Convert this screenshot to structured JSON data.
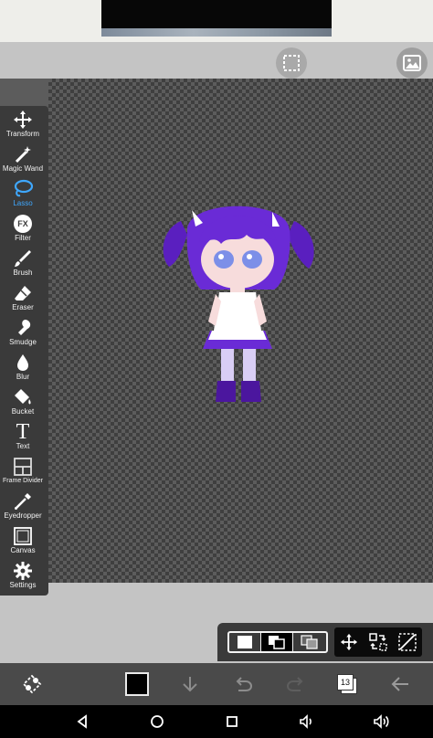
{
  "ad": {
    "banner": "ad-banner"
  },
  "tools": [
    {
      "label": "Transform",
      "icon": "move-arrows-icon"
    },
    {
      "label": "Magic Wand",
      "icon": "magic-wand-icon"
    },
    {
      "label": "Lasso",
      "icon": "lasso-icon",
      "active": true
    },
    {
      "label": "Filter",
      "icon": "fx-icon"
    },
    {
      "label": "Brush",
      "icon": "brush-icon"
    },
    {
      "label": "Eraser",
      "icon": "eraser-icon"
    },
    {
      "label": "Smudge",
      "icon": "smudge-icon"
    },
    {
      "label": "Blur",
      "icon": "drop-icon"
    },
    {
      "label": "Bucket",
      "icon": "bucket-icon"
    },
    {
      "label": "Text",
      "icon": "text-icon"
    },
    {
      "label": "Frame Divider",
      "icon": "frame-divider-icon"
    },
    {
      "label": "Eyedropper",
      "icon": "eyedropper-icon"
    },
    {
      "label": "Canvas",
      "icon": "canvas-icon"
    },
    {
      "label": "Settings",
      "icon": "gear-icon"
    }
  ],
  "fx_text": "FX",
  "text_tool_glyph": "T",
  "bottom": {
    "color": "#000000",
    "layer_count": "13"
  },
  "colors": {
    "accent": "#3fa8ff",
    "toolbar": "#3a3a3a",
    "bottom_bar": "#4a4a4a"
  }
}
